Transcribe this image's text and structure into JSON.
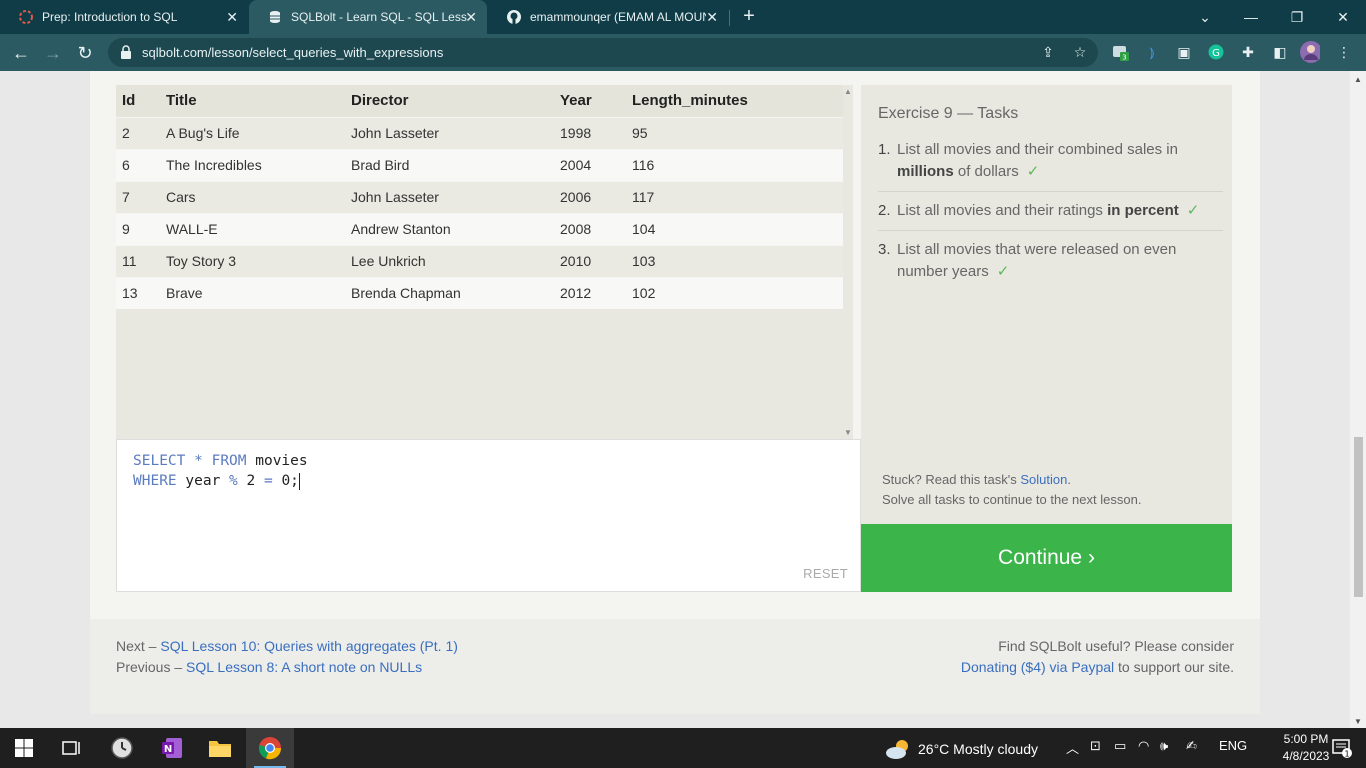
{
  "browser": {
    "tabs": [
      {
        "title": "Prep: Introduction to SQL",
        "active": false
      },
      {
        "title": "SQLBolt - Learn SQL - SQL Lesson",
        "active": true
      },
      {
        "title": "emammounqer (EMAM AL MOUN",
        "active": false
      }
    ],
    "url": "sqlbolt.com/lesson/select_queries_with_expressions",
    "extension_badge": "3"
  },
  "results": {
    "columns": [
      "Id",
      "Title",
      "Director",
      "Year",
      "Length_minutes"
    ],
    "rows": [
      [
        "2",
        "A Bug's Life",
        "John Lasseter",
        "1998",
        "95"
      ],
      [
        "6",
        "The Incredibles",
        "Brad Bird",
        "2004",
        "116"
      ],
      [
        "7",
        "Cars",
        "John Lasseter",
        "2006",
        "117"
      ],
      [
        "9",
        "WALL-E",
        "Andrew Stanton",
        "2008",
        "104"
      ],
      [
        "11",
        "Toy Story 3",
        "Lee Unkrich",
        "2010",
        "103"
      ],
      [
        "13",
        "Brave",
        "Brenda Chapman",
        "2012",
        "102"
      ]
    ]
  },
  "editor": {
    "line1": {
      "kw1": "SELECT",
      "op1": " * ",
      "kw2": "FROM",
      "text": " movies"
    },
    "line2": {
      "kw1": "WHERE",
      "text1": " year ",
      "op1": "%",
      "text2": " 2 ",
      "op2": "=",
      "text3": " 0;"
    },
    "reset_label": "RESET"
  },
  "tasks": {
    "heading": "Exercise 9 — Tasks",
    "items": [
      {
        "num": "1.",
        "pre": "List all movies and their combined sales in ",
        "bold": "millions",
        "post": " of dollars",
        "done": true
      },
      {
        "num": "2.",
        "pre": "List all movies and their ratings ",
        "bold": "in percent",
        "post": "",
        "done": true
      },
      {
        "num": "3.",
        "pre": "List all movies that were released on even number years",
        "bold": "",
        "post": "",
        "done": true
      }
    ],
    "check_mark": "✓",
    "stuck_text": "Stuck? Read this task's ",
    "solution_link": "Solution",
    "stuck_end": ".",
    "solve_all": "Solve all tasks to continue to the next lesson.",
    "continue_label": "Continue ›"
  },
  "footer": {
    "next_prefix": "Next – ",
    "next_link": "SQL Lesson 10: Queries with aggregates (Pt. 1)",
    "prev_prefix": "Previous – ",
    "prev_link": "SQL Lesson 8: A short note on NULLs",
    "useful": "Find SQLBolt useful? Please consider",
    "donate_link": "Donating ($4) via Paypal",
    "donate_suffix": " to support our site."
  },
  "taskbar": {
    "weather": "26°C  Mostly cloudy",
    "language": "ENG",
    "time": "5:00 PM",
    "date": "4/8/2023",
    "notification_count": "1"
  }
}
